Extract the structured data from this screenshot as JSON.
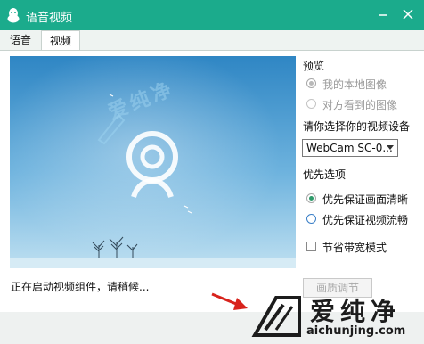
{
  "window": {
    "title": "语音视频"
  },
  "tabs": [
    {
      "label": "语音"
    },
    {
      "label": "视频"
    }
  ],
  "preview": {
    "status_text": "正在启动视频组件，请稍候...",
    "overlay_text": "爱纯净"
  },
  "settings": {
    "preview_heading": "预览",
    "preview_options": [
      {
        "label": "我的本地图像",
        "checked": true,
        "enabled": false
      },
      {
        "label": "对方看到的图像",
        "checked": false,
        "enabled": false
      }
    ],
    "device_heading": "请你选择你的视频设备",
    "device_select": {
      "value": "WebCam SC-0..."
    },
    "priority_heading": "优先选项",
    "priority_options": [
      {
        "label": "优先保证画面清晰",
        "checked": true
      },
      {
        "label": "优先保证视频流畅",
        "checked": false
      }
    ],
    "bandwidth_checkbox": {
      "label": "节省带宽模式",
      "checked": false
    },
    "adjust_button": "画质调节"
  },
  "watermark": {
    "brand_cn": "爱纯净",
    "brand_url": "aichunjing.com"
  },
  "colors": {
    "titlebar": "#1bab8c",
    "accent": "#2e9a6a"
  }
}
